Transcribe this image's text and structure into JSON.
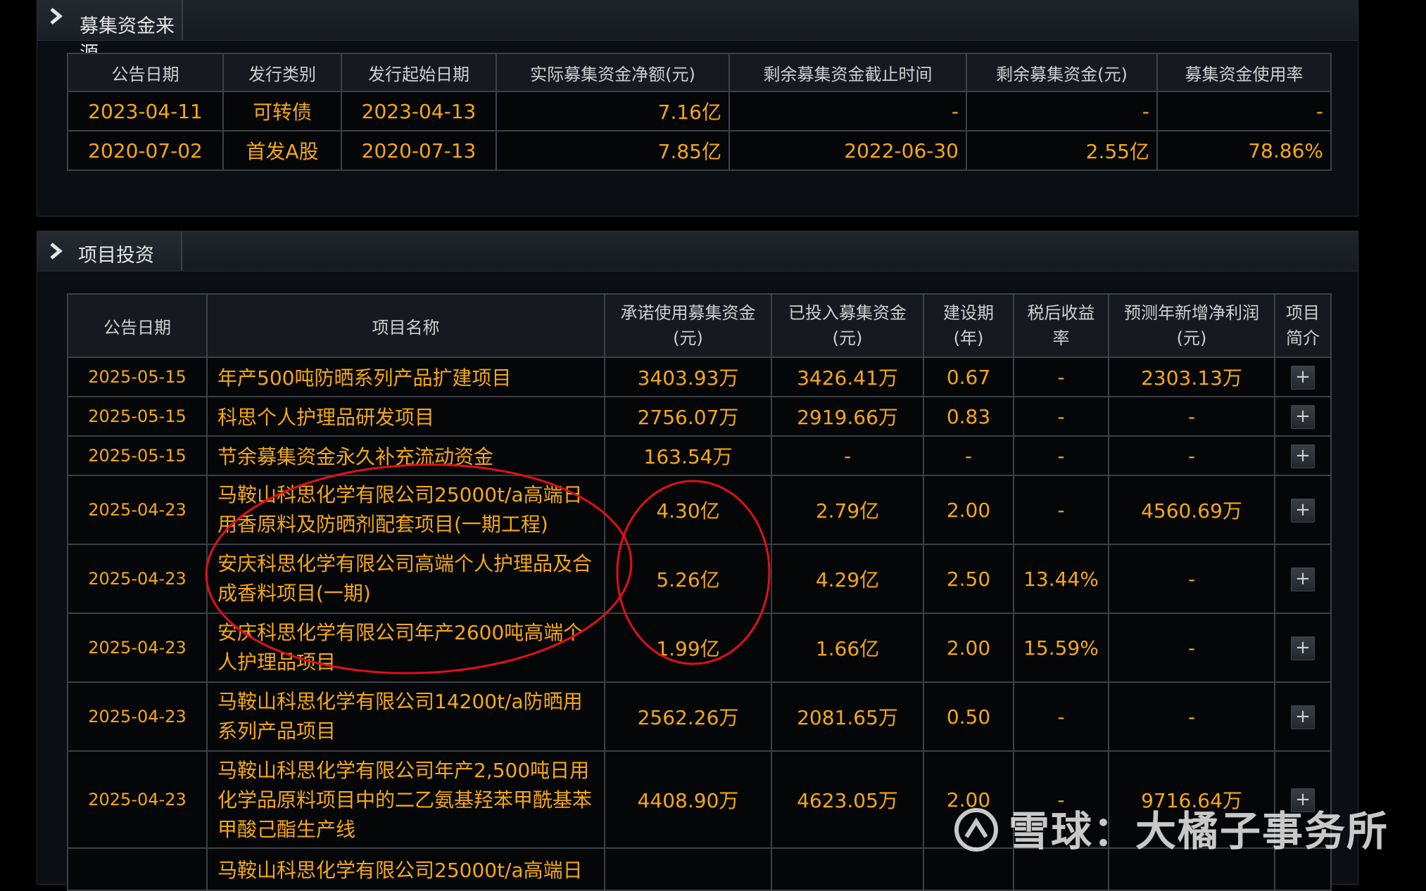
{
  "section1": {
    "title": "募集资金来源",
    "headers": [
      "公告日期",
      "发行类别",
      "发行起始日期",
      "实际募集资金净额(元)",
      "剩余募集资金截止时间",
      "剩余募集资金(元)",
      "募集资金使用率"
    ],
    "rows": [
      [
        "2023-04-11",
        "可转债",
        "2023-04-13",
        "7.16亿",
        "-",
        "-",
        "-"
      ],
      [
        "2020-07-02",
        "首发A股",
        "2020-07-13",
        "7.85亿",
        "2022-06-30",
        "2.55亿",
        "78.86%"
      ]
    ]
  },
  "section2": {
    "title": "项目投资",
    "headers": {
      "date": "公告日期",
      "name": "项目名称",
      "committed": "承诺使用募集资金",
      "committed_unit": "(元)",
      "invested": "已投入募集资金",
      "invested_unit": "(元)",
      "period": "建设期",
      "period_unit": "(年)",
      "irr": "税后收益率",
      "profit": "预测年新增净利润",
      "profit_unit": "(元)",
      "intro": "项目简介"
    },
    "expand_icon": "+",
    "rows": [
      [
        "2025-05-15",
        "年产500吨防晒系列产品扩建项目",
        "3403.93万",
        "3426.41万",
        "0.67",
        "-",
        "2303.13万"
      ],
      [
        "2025-05-15",
        "科思个人护理品研发项目",
        "2756.07万",
        "2919.66万",
        "0.83",
        "-",
        "-"
      ],
      [
        "2025-05-15",
        "节余募集资金永久补充流动资金",
        "163.54万",
        "-",
        "-",
        "-",
        "-"
      ],
      [
        "2025-04-23",
        "马鞍山科思化学有限公司25000t/a高端日用香原料及防晒剂配套项目(一期工程)",
        "4.30亿",
        "2.79亿",
        "2.00",
        "-",
        "4560.69万"
      ],
      [
        "2025-04-23",
        "安庆科思化学有限公司高端个人护理品及合成香料项目(一期)",
        "5.26亿",
        "4.29亿",
        "2.50",
        "13.44%",
        "-"
      ],
      [
        "2025-04-23",
        "安庆科思化学有限公司年产2600吨高端个人护理品项目",
        "1.99亿",
        "1.66亿",
        "2.00",
        "15.59%",
        "-"
      ],
      [
        "2025-04-23",
        "马鞍山科思化学有限公司14200t/a防晒用系列产品项目",
        "2562.26万",
        "2081.65万",
        "0.50",
        "-",
        "-"
      ],
      [
        "2025-04-23",
        "马鞍山科思化学有限公司年产2,500吨日用化学品原料项目中的二乙氨基羟苯甲酰基苯甲酸己酯生产线",
        "4408.90万",
        "4623.05万",
        "2.00",
        "-",
        "9716.64万"
      ],
      [
        "",
        "马鞍山科思化学有限公司25000t/a高端日",
        "",
        "",
        "",
        "",
        ""
      ]
    ]
  },
  "watermark": "雪球：大橘子事务所",
  "colors": {
    "value": "#f5a90f",
    "annotation": "#e0101a"
  }
}
